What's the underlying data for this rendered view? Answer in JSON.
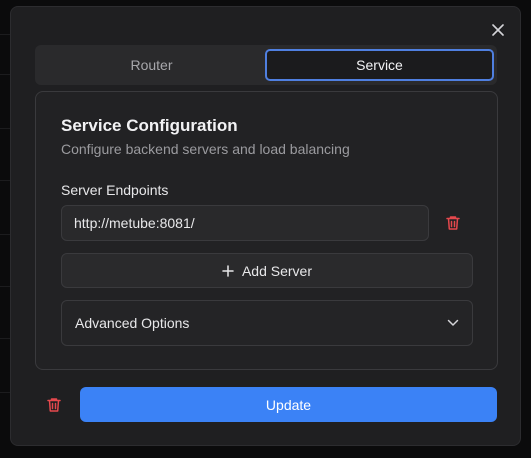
{
  "dialog": {
    "close_icon": "close-icon"
  },
  "tabs": [
    {
      "label": "Router",
      "active": false
    },
    {
      "label": "Service",
      "active": true
    }
  ],
  "card": {
    "title": "Service Configuration",
    "subtitle": "Configure backend servers and load balancing",
    "endpoints_label": "Server Endpoints",
    "endpoints": [
      {
        "value": "http://metube:8081/"
      }
    ],
    "add_server_label": "Add Server",
    "advanced_label": "Advanced Options"
  },
  "footer": {
    "update_label": "Update"
  },
  "colors": {
    "accent": "#3b82f6",
    "danger": "#e5484d",
    "tab_focus": "#4f7fe0"
  }
}
